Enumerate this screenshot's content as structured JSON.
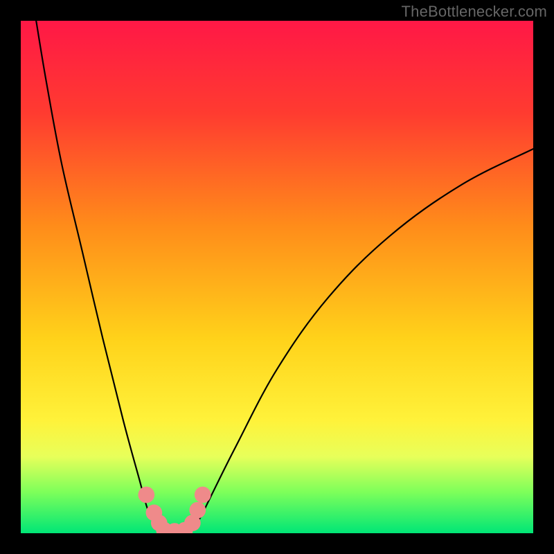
{
  "attribution": "TheBottlenecker.com",
  "chart_data": {
    "type": "line",
    "title": "",
    "xlabel": "",
    "ylabel": "",
    "xlim": [
      0,
      100
    ],
    "ylim": [
      0,
      100
    ],
    "gradient_stops": [
      {
        "offset": 0,
        "color": "#ff1846"
      },
      {
        "offset": 18,
        "color": "#ff3b30"
      },
      {
        "offset": 40,
        "color": "#ff8c1a"
      },
      {
        "offset": 62,
        "color": "#ffd21a"
      },
      {
        "offset": 78,
        "color": "#fff23a"
      },
      {
        "offset": 85,
        "color": "#e8ff5a"
      },
      {
        "offset": 92,
        "color": "#7dff5a"
      },
      {
        "offset": 100,
        "color": "#00e676"
      }
    ],
    "series": [
      {
        "name": "curve-left",
        "x": [
          3,
          5,
          8,
          12,
          16,
          20,
          23,
          25,
          27,
          28.5
        ],
        "values": [
          100,
          88,
          72,
          55,
          38,
          22,
          11,
          4,
          1,
          0
        ]
      },
      {
        "name": "curve-right",
        "x": [
          33,
          35,
          37,
          42,
          50,
          60,
          72,
          86,
          100
        ],
        "values": [
          0,
          3,
          7,
          17,
          32,
          46,
          58,
          68,
          75
        ]
      }
    ],
    "markers": [
      {
        "x": 24.5,
        "y": 7.5,
        "r": 1.6
      },
      {
        "x": 26,
        "y": 4,
        "r": 1.6
      },
      {
        "x": 27,
        "y": 2,
        "r": 1.6
      },
      {
        "x": 28,
        "y": 0.6,
        "r": 1.6
      },
      {
        "x": 30,
        "y": 0.4,
        "r": 1.6
      },
      {
        "x": 32,
        "y": 0.6,
        "r": 1.6
      },
      {
        "x": 33.5,
        "y": 2,
        "r": 1.6
      },
      {
        "x": 34.5,
        "y": 4.5,
        "r": 1.6
      },
      {
        "x": 35.5,
        "y": 7.5,
        "r": 1.6
      }
    ],
    "marker_color": "#ef8a8a",
    "curve_color": "#000000",
    "curve_width": 2.2
  }
}
